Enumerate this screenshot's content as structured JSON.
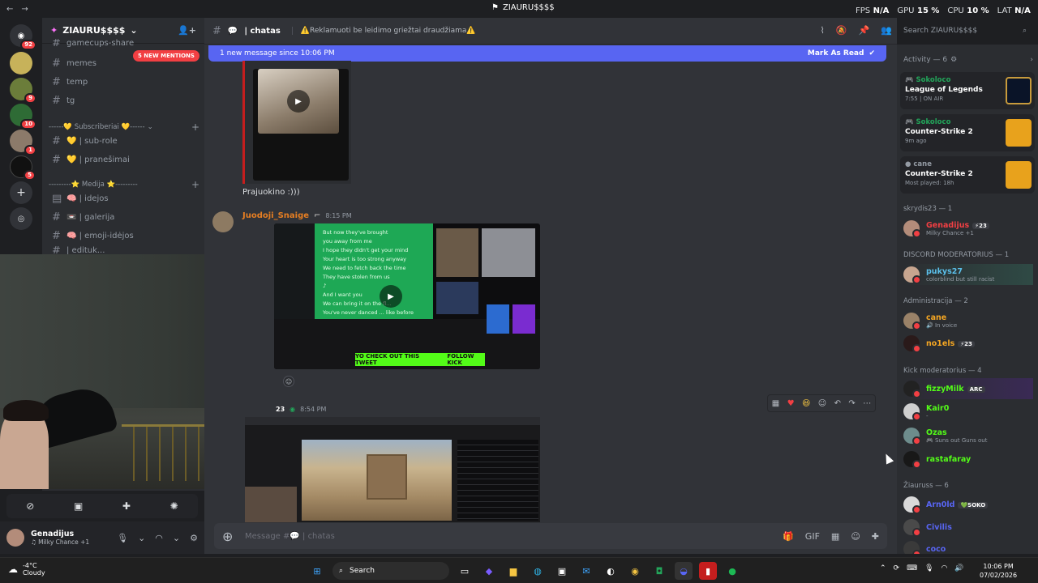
{
  "window": {
    "title": "ZIAURU$$$$",
    "overlay": {
      "fps_label": "FPS",
      "fps_value": "N/A",
      "gpu_label": "GPU",
      "gpu_value": "15 %",
      "cpu_label": "CPU",
      "cpu_value": "10 %",
      "lat_label": "LAT",
      "lat_value": "N/A"
    }
  },
  "rail": {
    "badges": [
      "92",
      "9",
      "10",
      "1",
      "5"
    ]
  },
  "server": {
    "name": "ZIAURU$$$$",
    "new_mentions": "5 NEW MENTIONS",
    "channels_top": [
      "gamecups-share",
      "memes",
      "temp",
      "tg"
    ],
    "category_1": "------💛 Subscriberiai 💛------",
    "cat1_channels": [
      "💛 | sub-role",
      "💛 | pranešimai"
    ],
    "category_2": "---------⭐ Medija ⭐---------",
    "cat2_channels": [
      "🧠 | idejos",
      "📼 | galerija",
      "🧠 | emoji-idėjos",
      "| edituk..."
    ]
  },
  "user": {
    "name": "Genadijus",
    "status": "Milky Chance +1"
  },
  "chat": {
    "channel": "| chatas",
    "topic": "⚠️Reklamuoti be leidimo griežtai draudžiama⚠️",
    "search_placeholder": "Search ZIAURU$$$$",
    "new_message_bar": "1 new message since 10:06 PM",
    "mark_as_read": "Mark As Read",
    "msg1_text": "Prajuokino :)))",
    "msg2_author": "Juodoji_Snaige",
    "msg2_time": "8:15 PM",
    "stream_lyrics": [
      "But now they've brought",
      "you away from me",
      "I hope they didn't get your mind",
      "Your heart is too strong anyway",
      "We need to fetch back the time",
      "They have stolen from us",
      "♪",
      "And I want you",
      "We can bring it on the fl...",
      "You've never danced ... like before"
    ],
    "stream_banner": "YO CHECK OUT THIS TWEET",
    "stream_follow": "FOLLOW KICK",
    "msg3_level": "23",
    "msg3_time": "8:54 PM",
    "composer_placeholder": "Message #💬 | chatas"
  },
  "members": {
    "activity_header": "Activity — 6",
    "activity": [
      {
        "user": "Sokoloco",
        "game": "League of Legends",
        "sub": "7:55 | ON AIR",
        "color": "#c89b3c"
      },
      {
        "user": "Sokoloco",
        "game": "Counter-Strike 2",
        "sub": "9m ago",
        "color": "#e8a21c"
      },
      {
        "user": "cane",
        "game": "Counter-Strike 2",
        "sub": "Most played: 18h",
        "color": "#e8a21c"
      }
    ],
    "groups": [
      {
        "title": "skrydis23 — 1",
        "members": [
          {
            "name": "Genadijus",
            "tag": "⚡23",
            "status": "Milky Chance +1",
            "color": "#f23f43"
          }
        ]
      },
      {
        "title": "DISCORD MODERATORIUS — 1",
        "members": [
          {
            "name": "pukys27",
            "tag": "",
            "status": "colorblind but still racist",
            "color": "#5bc0eb"
          }
        ]
      },
      {
        "title": "Administracija — 2",
        "members": [
          {
            "name": "cane",
            "tag": "",
            "status": "In voice",
            "color": "#f5a623"
          },
          {
            "name": "no1els",
            "tag": "⚡23",
            "status": "",
            "color": "#f5a623"
          }
        ]
      },
      {
        "title": "Kick moderatorius — 4",
        "members": [
          {
            "name": "fizzyMilk",
            "tag": "ARC",
            "status": "",
            "color": "#53fc18"
          },
          {
            "name": "Kair0",
            "tag": "",
            "status": "-",
            "color": "#53fc18"
          },
          {
            "name": "Ozas",
            "tag": "",
            "status": "Suns out Guns out",
            "color": "#53fc18"
          },
          {
            "name": "rastafaray",
            "tag": "",
            "status": "",
            "color": "#53fc18"
          }
        ]
      },
      {
        "title": "Žiauruss — 6",
        "members": [
          {
            "name": "Arn0ld",
            "tag": "💚SOKO",
            "status": "",
            "color": "#5865f2"
          },
          {
            "name": "Civilis",
            "tag": "",
            "status": "",
            "color": "#5865f2"
          },
          {
            "name": "coco",
            "tag": "",
            "status": "",
            "color": "#5865f2"
          }
        ]
      }
    ]
  },
  "taskbar": {
    "temp": "-4°C",
    "weather": "Cloudy",
    "search": "Search",
    "time": "10:06 PM",
    "date": "07/02/2026"
  },
  "colors": {
    "accent": "#5865f2",
    "online": "#23a55a",
    "dnd": "#f23f43",
    "kick_green": "#53fc18"
  }
}
